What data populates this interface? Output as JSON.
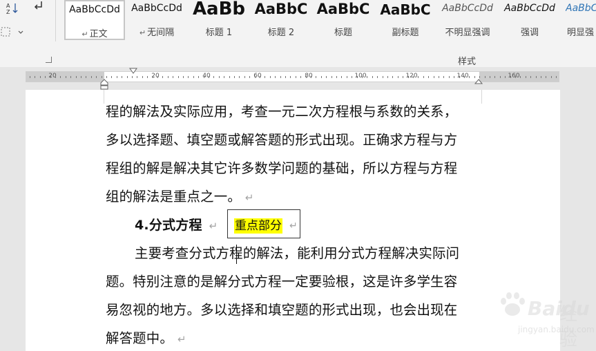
{
  "ribbon": {
    "styles": [
      {
        "preview": "AaBbCcDd",
        "name": "正文",
        "mark": "↵",
        "active": true
      },
      {
        "preview": "AaBbCcDd",
        "name": "无间隔",
        "mark": "↵",
        "active": false
      },
      {
        "preview": "AaBb",
        "name": "标题 1",
        "mark": "",
        "active": false
      },
      {
        "preview": "AaBbC",
        "name": "标题 2",
        "mark": "",
        "active": false
      },
      {
        "preview": "AaBbC",
        "name": "标题",
        "mark": "",
        "active": false
      },
      {
        "preview": "AaBbC",
        "name": "副标题",
        "mark": "",
        "active": false
      },
      {
        "preview": "AaBbCcDd",
        "name": "不明显强调",
        "mark": "",
        "active": false
      },
      {
        "preview": "AaBbCcDd",
        "name": "强调",
        "mark": "",
        "active": false
      },
      {
        "preview": "AaBbCcDd",
        "name": "明显强",
        "mark": "",
        "active": false
      }
    ],
    "group_label": "样式"
  },
  "ruler": {
    "labels": [
      "20",
      "20",
      "40",
      "60",
      "80",
      "100",
      "120",
      "140",
      "160"
    ]
  },
  "document": {
    "lines": [
      "程的解法及实际应用，考查一元二次方程根与系数的关系，",
      "多以选择题、填空题或解答题的形式出现。正确求方程与方",
      "程组的解是解决其它许多数学问题的基础，所以方程与方程",
      "组的解法是重点之一。"
    ],
    "heading": "4.分式方程",
    "callout": "重点部分",
    "paragraph2": [
      "主要考查分式方程的解法，能利用分式方程解决实际问",
      "题。特别注意的是解分式方程一定要验根，这是许多学生容",
      "易忽视的地方。多以选择和填空题的形式出现，也会出现在",
      "解答题中。"
    ],
    "para_mark": "↵"
  },
  "watermark": {
    "brand": "Baidu",
    "jing": "经验",
    "url": "jingyan.baidu.com"
  },
  "colors": {
    "highlight": "#ffff00",
    "ribbon_bg": "#f3f3f3",
    "page_bg": "#ffffff"
  }
}
